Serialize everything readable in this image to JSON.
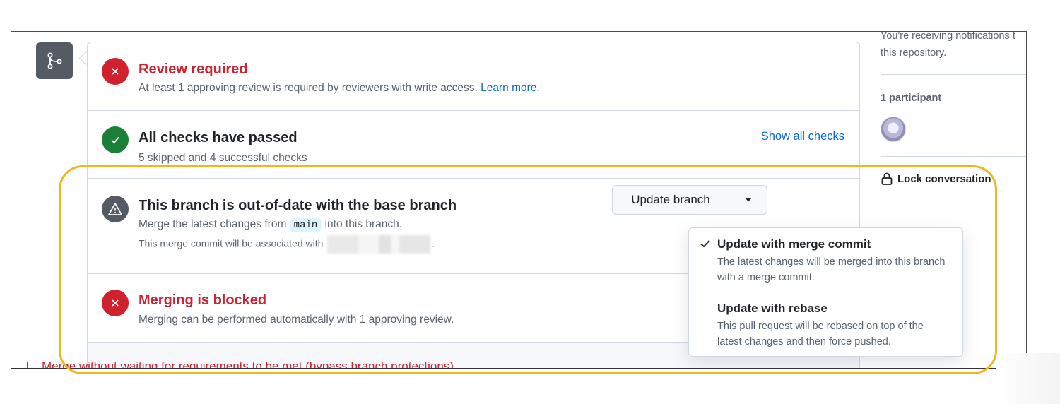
{
  "merge_box": {
    "review": {
      "title": "Review required",
      "description": "At least 1 approving review is required by reviewers with write access.",
      "learn_more": "Learn more."
    },
    "checks": {
      "title": "All checks have passed",
      "description": "5 skipped and 4 successful checks",
      "show_all": "Show all checks"
    },
    "out_of_date": {
      "title": "This branch is out-of-date with the base branch",
      "desc_before": "Merge the latest changes from",
      "branch": "main",
      "desc_after": "into this branch.",
      "assoc_before": "This merge commit will be associated with",
      "assoc_after": ".",
      "update_button": "Update branch"
    },
    "blocked": {
      "title": "Merging is blocked",
      "description": "Merging can be performed automatically with 1 approving review."
    },
    "bypass_label": "Merge without waiting for requirements to be met (bypass branch protections)"
  },
  "dropdown": {
    "items": [
      {
        "title": "Update with merge commit",
        "description": "The latest changes will be merged into this branch with a merge commit.",
        "selected": true
      },
      {
        "title": "Update with rebase",
        "description": "This pull request will be rebased on top of the latest changes and then force pushed.",
        "selected": false
      }
    ]
  },
  "sidebar": {
    "notifications_line1": "You're receiving notifications t",
    "notifications_line2": "this repository.",
    "participants": "1 participant",
    "lock": "Lock conversation"
  },
  "colors": {
    "danger": "#cf222e",
    "success": "#1a7f37",
    "link": "#0969da",
    "highlight": "#f2b61d"
  },
  "icons": [
    "git-merge-icon",
    "x-circle-icon",
    "check-circle-icon",
    "alert-icon",
    "triangle-down-icon",
    "check-icon",
    "lock-icon"
  ]
}
